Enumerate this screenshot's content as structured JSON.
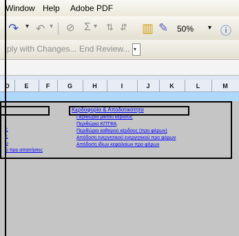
{
  "menu": {
    "window": "Window",
    "help": "Help",
    "adobe_pdf": "Adobe PDF"
  },
  "toolbar": {
    "zoom": "50%",
    "reply_changes": "ply with Changes...",
    "end_review": "End Review..."
  },
  "columns": [
    "D",
    "E",
    "F",
    "G",
    "H",
    "I",
    "J",
    "K",
    "L",
    "M"
  ],
  "section": {
    "title": "Κερδοφορία & Αποδοτικότητα",
    "links": [
      "Περιθώριο μικτού κέρδους",
      "Περιθώριο ΚΠΤΦΑ",
      "Περιθώριο καθαρού κέρδους (προ φόρων)",
      "Απόδοση ενεργητικού ενεργητικού προ φόρων",
      "Απόδοση ιδίων κεφαλαίων προ φόρων"
    ],
    "left_fragments": [
      "ς",
      "ς",
      "υ",
      "ύ προ απαιτήσεις"
    ]
  }
}
